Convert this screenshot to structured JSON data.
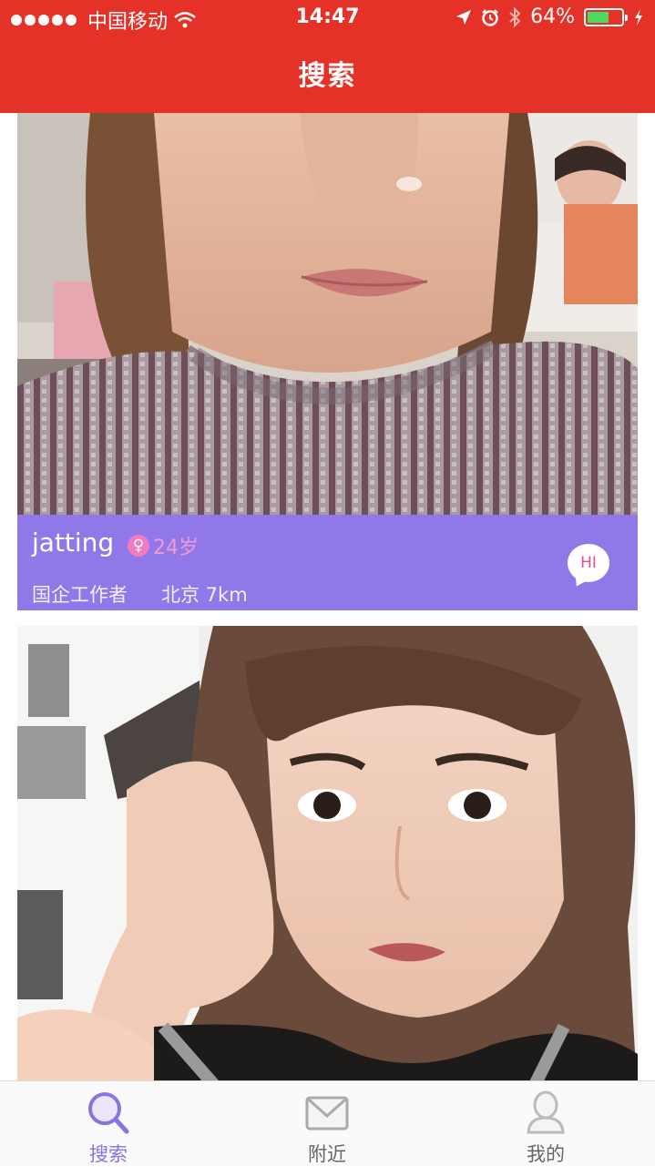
{
  "status_bar": {
    "carrier": "中国移动",
    "time": "14:47",
    "battery_percent": "64%",
    "battery_level": 0.64
  },
  "header": {
    "title": "搜索"
  },
  "cards": [
    {
      "username": "jatting",
      "gender": "female",
      "age": "24岁",
      "occupation": "国企工作者",
      "location": "北京 7km",
      "greet_label": "HI"
    }
  ],
  "tab_bar": {
    "tabs": [
      {
        "label": "搜索",
        "icon": "search-icon",
        "active": true
      },
      {
        "label": "附近",
        "icon": "mail-icon",
        "active": false
      },
      {
        "label": "我的",
        "icon": "user-icon",
        "active": false
      }
    ]
  },
  "colors": {
    "header_red": "#e53228",
    "info_bar_purple": "#9178e8",
    "active_tab": "#8a73e0",
    "age_pink": "#f39ad0"
  }
}
